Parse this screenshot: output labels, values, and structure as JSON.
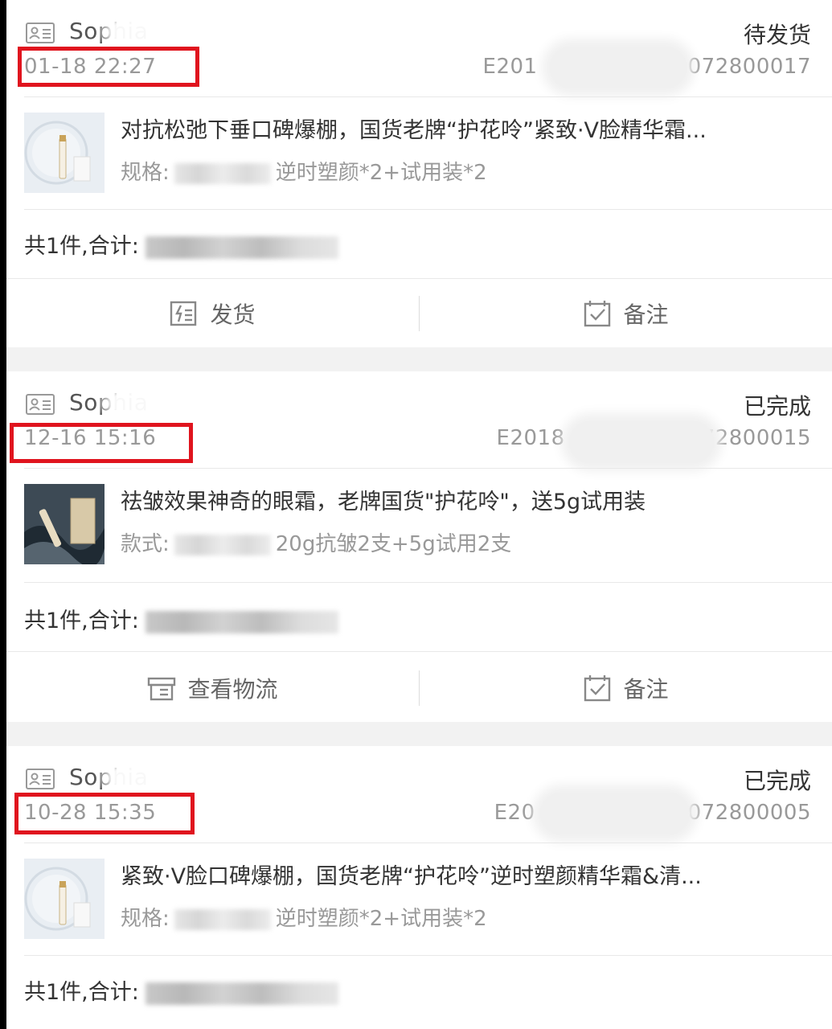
{
  "orders": [
    {
      "user": "Sophia",
      "time": "01-18 22:27",
      "status": "待发货",
      "order_no_prefix": "E201",
      "order_no_suffix": "5072800017",
      "product_title": "对抗松弛下垂口碑爆棚，国货老牌“护花呤”紧致·V脸精华霜...",
      "spec_label": "规格:",
      "spec_value": "逆时塑颜*2+试用装*2",
      "total_label": "共1件,合计:",
      "actions": [
        {
          "label": "发货",
          "icon": "ship-icon"
        },
        {
          "label": "备注",
          "icon": "note-icon"
        }
      ]
    },
    {
      "user": "Sophia",
      "time": "12-16 15:16",
      "status": "已完成",
      "order_no_prefix": "E2018",
      "order_no_suffix": "72800015",
      "product_title": "祛皱效果神奇的眼霜，老牌国货\"护花呤\"，送5g试用装",
      "spec_label": "款式:",
      "spec_value": "20g抗皱2支+5g试用2支",
      "total_label": "共1件,合计:",
      "actions": [
        {
          "label": "查看物流",
          "icon": "logistics-icon"
        },
        {
          "label": "备注",
          "icon": "note-icon"
        }
      ]
    },
    {
      "user": "Sophia",
      "time": "10-28 15:35",
      "status": "已完成",
      "order_no_prefix": "E20",
      "order_no_suffix": "072800005",
      "product_title": "紧致·V脸口碑爆棚，国货老牌“护花呤”逆时塑颜精华霜&清...",
      "spec_label": "规格:",
      "spec_value": "逆时塑颜*2+试用装*2",
      "total_label": "共1件,合计:"
    }
  ],
  "colors": {
    "highlight_box": "#e0141e",
    "page_bg": "#f2f2f2"
  }
}
